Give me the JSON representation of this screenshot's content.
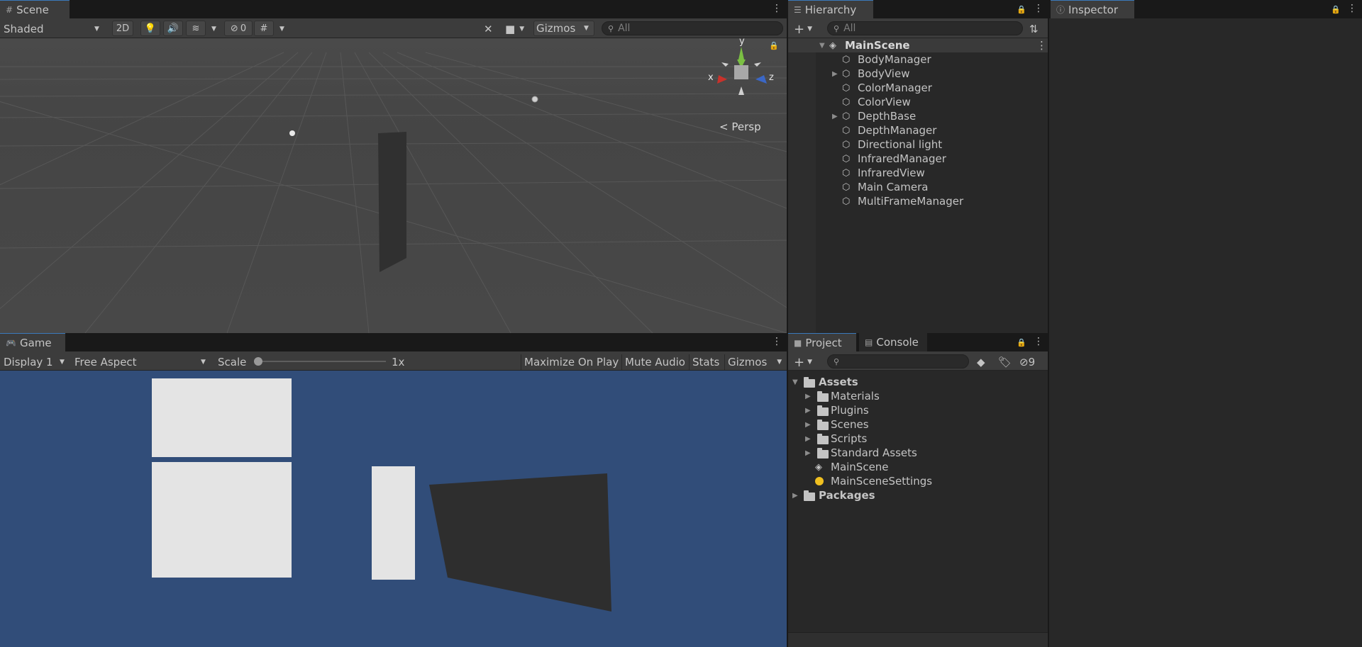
{
  "scene": {
    "tab_label": "Scene",
    "shading_mode": "Shaded",
    "btn_2d": "2D",
    "hidden_count": "0",
    "gizmos_label": "Gizmos",
    "search_placeholder": "All",
    "axis_y": "y",
    "axis_x": "x",
    "axis_z": "z",
    "persp_label": "Persp"
  },
  "game": {
    "tab_label": "Game",
    "display": "Display 1",
    "aspect": "Free Aspect",
    "scale_label": "Scale",
    "scale_value": "1x",
    "maximize_on_play": "Maximize On Play",
    "mute_audio": "Mute Audio",
    "stats": "Stats",
    "gizmos": "Gizmos",
    "background_color": "#314d79"
  },
  "hierarchy": {
    "tab_label": "Hierarchy",
    "search_placeholder": "All",
    "scene_name": "MainScene",
    "items": [
      {
        "label": "BodyManager",
        "expandable": false
      },
      {
        "label": "BodyView",
        "expandable": true
      },
      {
        "label": "ColorManager",
        "expandable": false
      },
      {
        "label": "ColorView",
        "expandable": false
      },
      {
        "label": "DepthBase",
        "expandable": true
      },
      {
        "label": "DepthManager",
        "expandable": false
      },
      {
        "label": "Directional light",
        "expandable": false
      },
      {
        "label": "InfraredManager",
        "expandable": false
      },
      {
        "label": "InfraredView",
        "expandable": false
      },
      {
        "label": "Main Camera",
        "expandable": false
      },
      {
        "label": "MultiFrameManager",
        "expandable": false
      }
    ]
  },
  "inspector": {
    "tab_label": "Inspector"
  },
  "project": {
    "tab_label": "Project",
    "console_tab_label": "Console",
    "hidden_count": "9",
    "assets_label": "Assets",
    "folders": [
      "Materials",
      "Plugins",
      "Scenes",
      "Scripts",
      "Standard Assets"
    ],
    "scene_asset": "MainScene",
    "settings_asset": "MainSceneSettings",
    "packages_label": "Packages"
  }
}
